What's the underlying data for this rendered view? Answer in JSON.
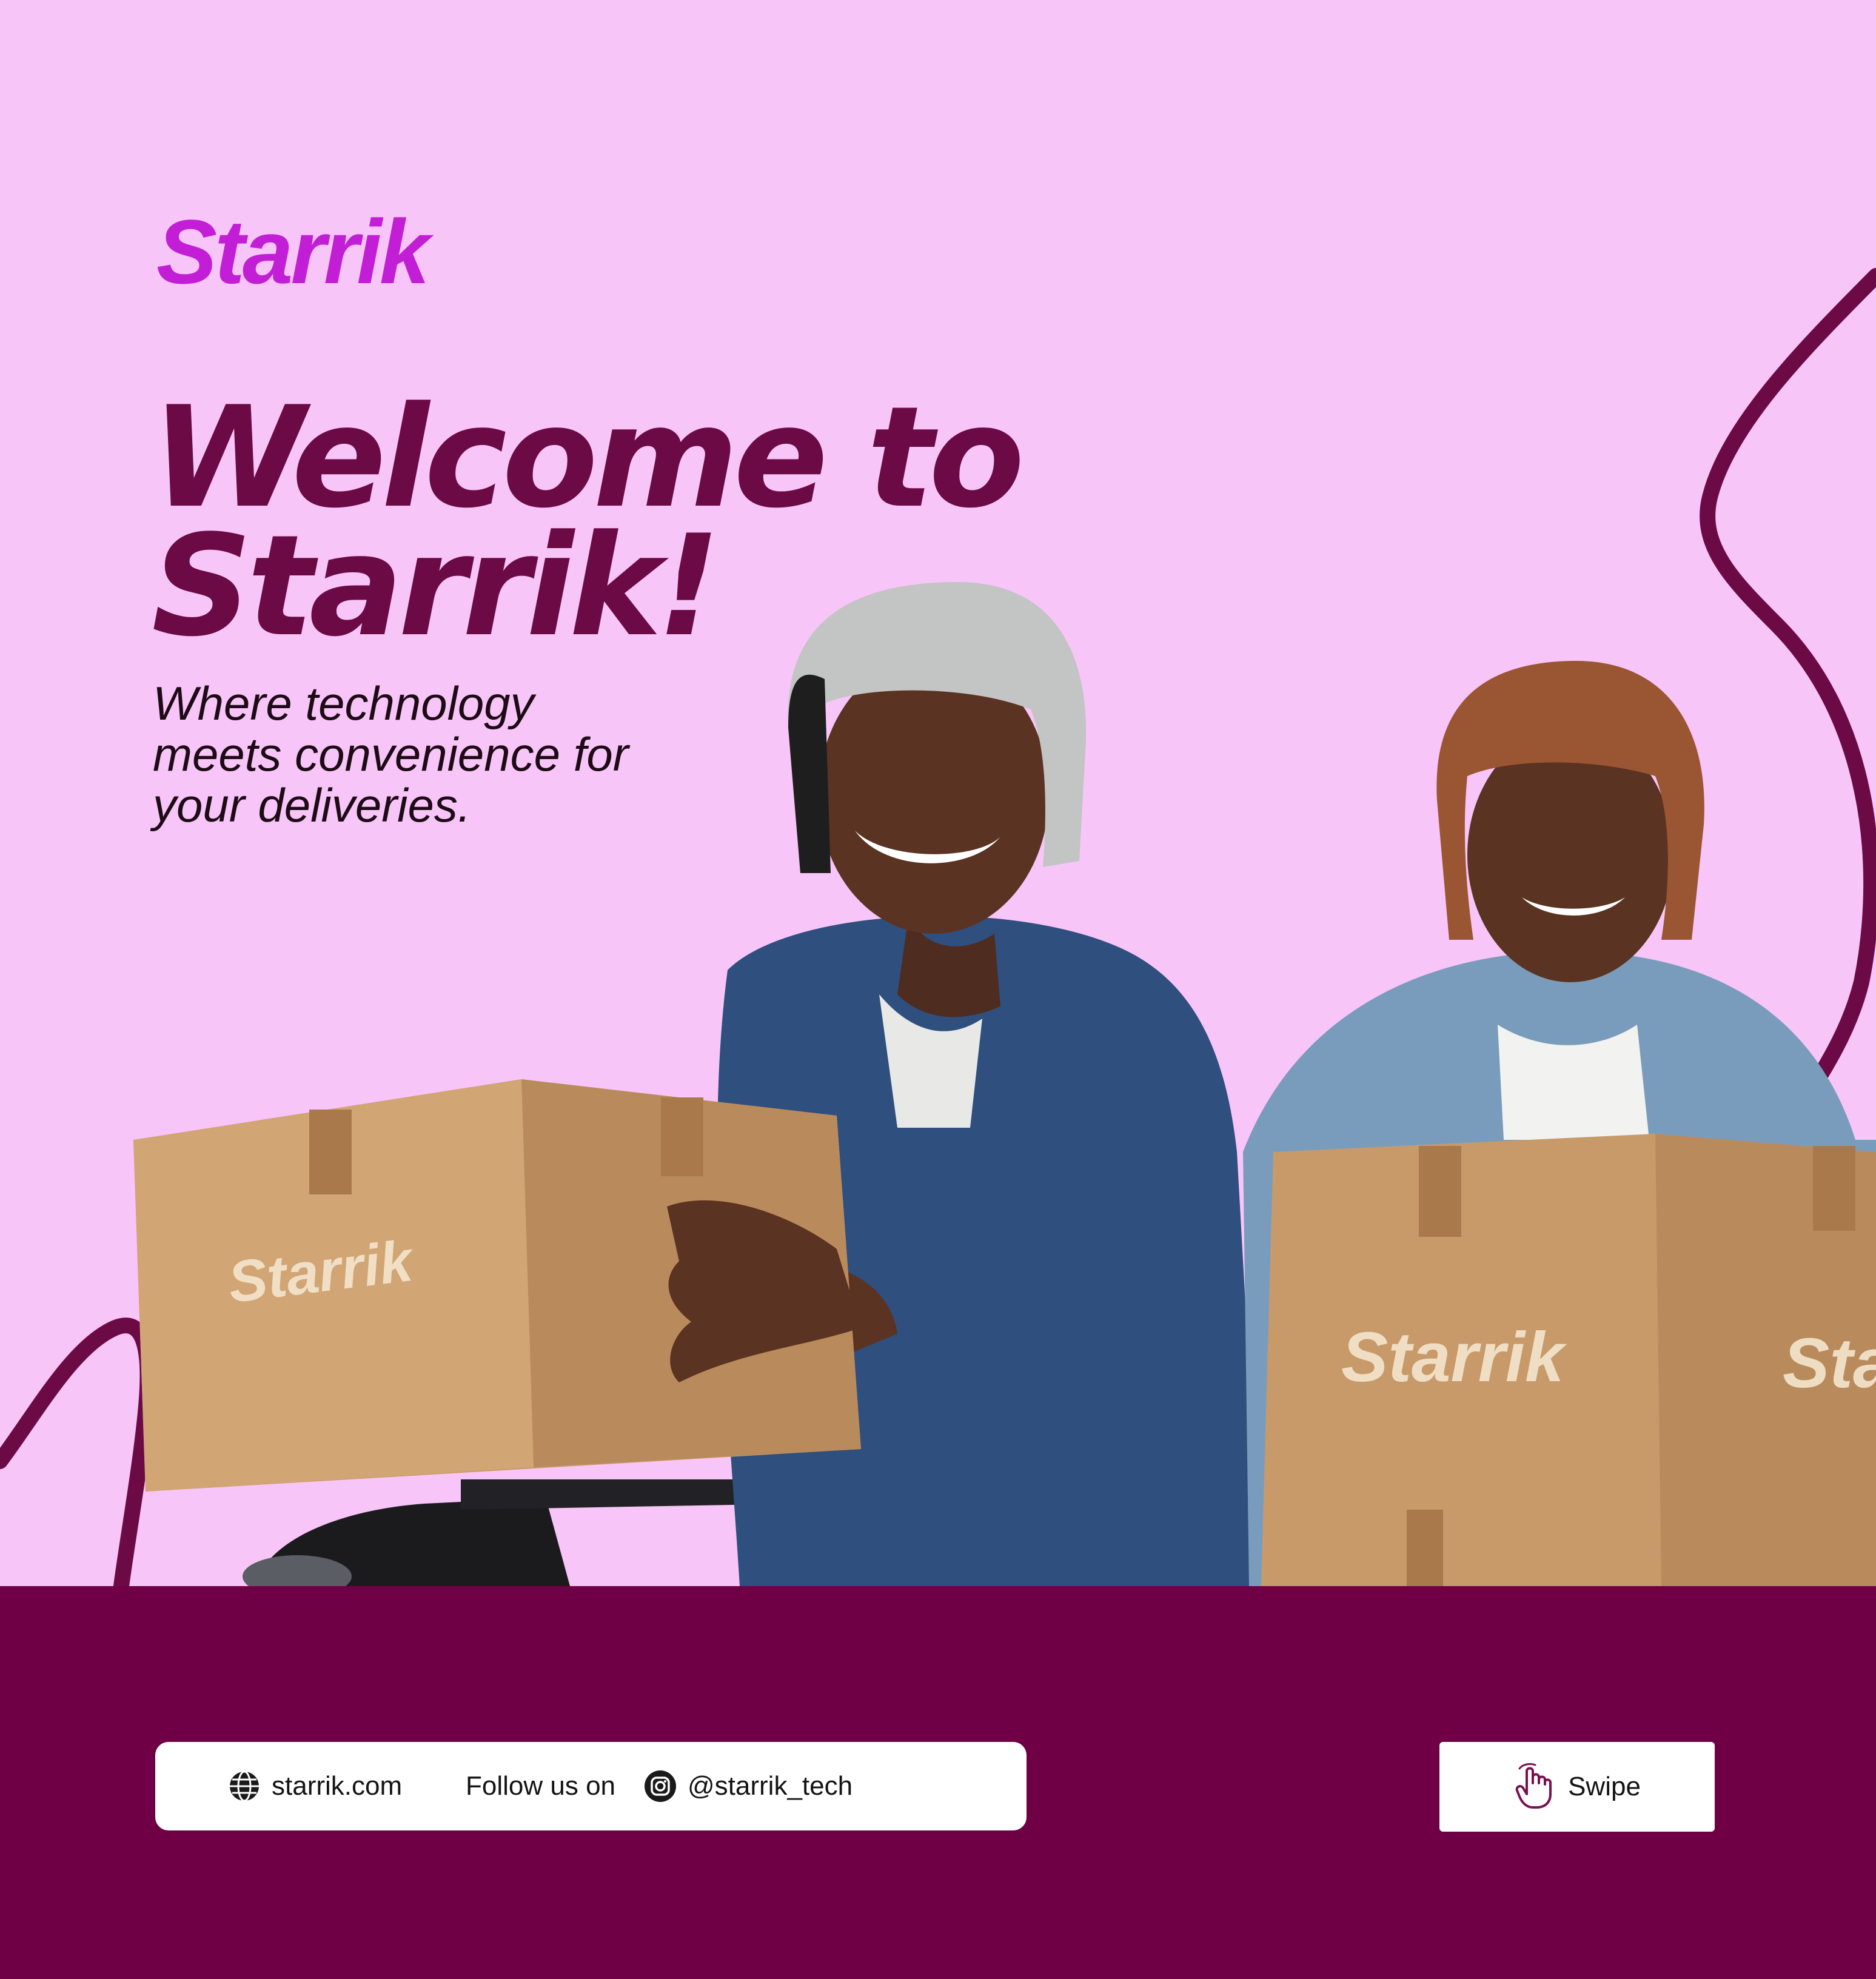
{
  "brand": {
    "logo_text": "Starrik",
    "box_logo_text": "Starrik",
    "box_logo_partial": "Star"
  },
  "hero": {
    "headline": "Welcome to\nStarrik!",
    "tagline": "Where technology\nmeets convenience for\nyour deliveries."
  },
  "footer": {
    "website": "starrik.com",
    "follow_label": "Follow us on",
    "instagram_handle": "@starrik_tech",
    "swipe_label": "Swipe"
  },
  "icons": {
    "website": "globe-icon",
    "social": "instagram-icon",
    "swipe": "hand-pointer-icon"
  },
  "colors": {
    "background": "#f8c5f8",
    "band": "#700045",
    "headline": "#6b0a44",
    "logo": "#c21ed6"
  }
}
